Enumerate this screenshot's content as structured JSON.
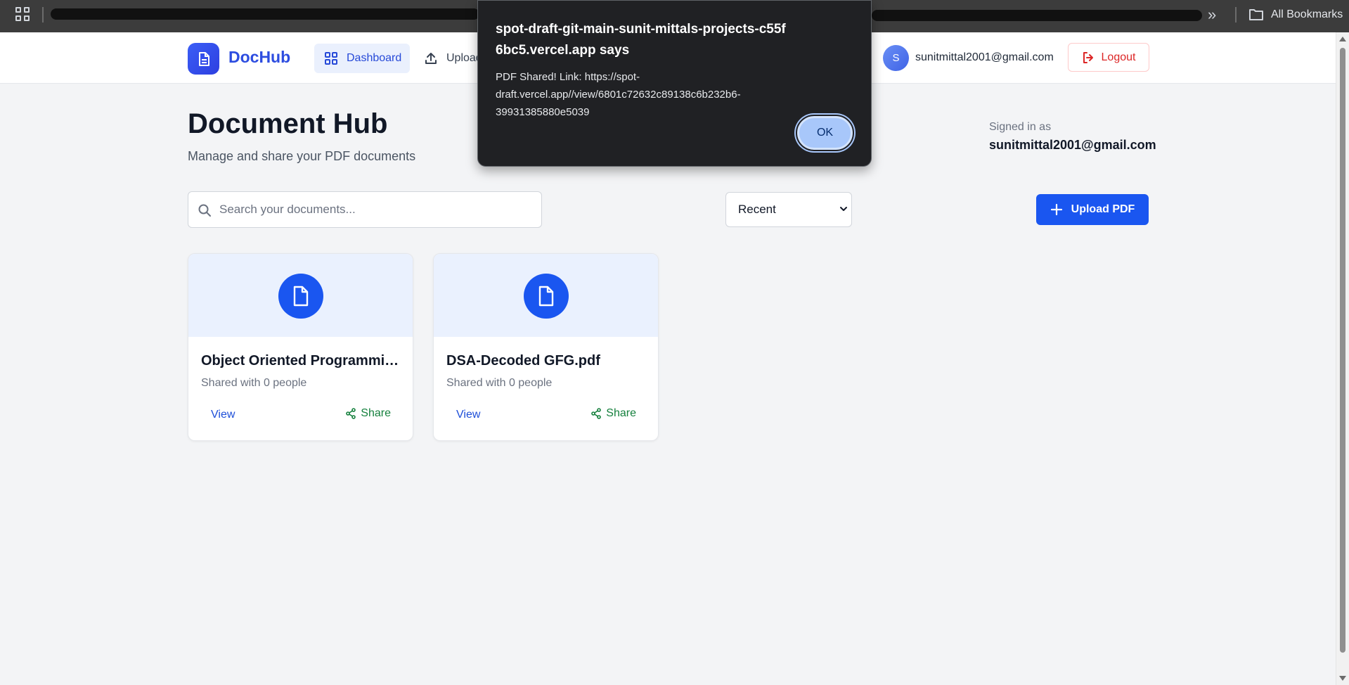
{
  "browser": {
    "all_bookmarks_label": "All Bookmarks",
    "more_label": "»"
  },
  "header": {
    "logo_text": "DocHub",
    "nav": {
      "dashboard_label": "Dashboard",
      "upload_label": "Upload"
    },
    "avatar_initial": "S",
    "user_email": "sunitmittal2001@gmail.com",
    "logout_label": "Logout"
  },
  "page": {
    "title": "Document Hub",
    "subtitle": "Manage and share your PDF documents",
    "signed_in_label": "Signed in as",
    "signed_in_email": "sunitmittal2001@gmail.com"
  },
  "controls": {
    "search_placeholder": "Search your documents...",
    "search_value": "",
    "sort_selected": "Recent",
    "upload_button_label": "Upload PDF"
  },
  "documents": [
    {
      "title": "Object Oriented Programmin...",
      "shared_text": "Shared with 0 people",
      "view_label": "View",
      "share_label": "Share"
    },
    {
      "title": "DSA-Decoded GFG.pdf",
      "shared_text": "Shared with 0 people",
      "view_label": "View",
      "share_label": "Share"
    }
  ],
  "dialog": {
    "title": "spot-draft-git-main-sunit-mittals-projects-c55f6bc5.vercel.app says",
    "message": "PDF Shared! Link: https://spot-draft.vercel.app//view/6801c72632c89138c6b232b6-39931385880e5039",
    "ok_label": "OK"
  },
  "colors": {
    "brand": "#2d4de0",
    "primary_button": "#1a56f0",
    "share_green": "#15803d",
    "logout_red": "#dc2626",
    "dialog_bg": "#202124",
    "dialog_ok": "#a8c7fa"
  },
  "icons": {
    "apps": "apps-grid-icon",
    "folder": "folder-icon",
    "logo": "document-icon",
    "dashboard": "grid-icon",
    "upload": "upload-icon",
    "logout": "logout-icon",
    "search": "search-icon",
    "plus": "plus-icon",
    "file": "file-icon",
    "share": "share-icon"
  }
}
